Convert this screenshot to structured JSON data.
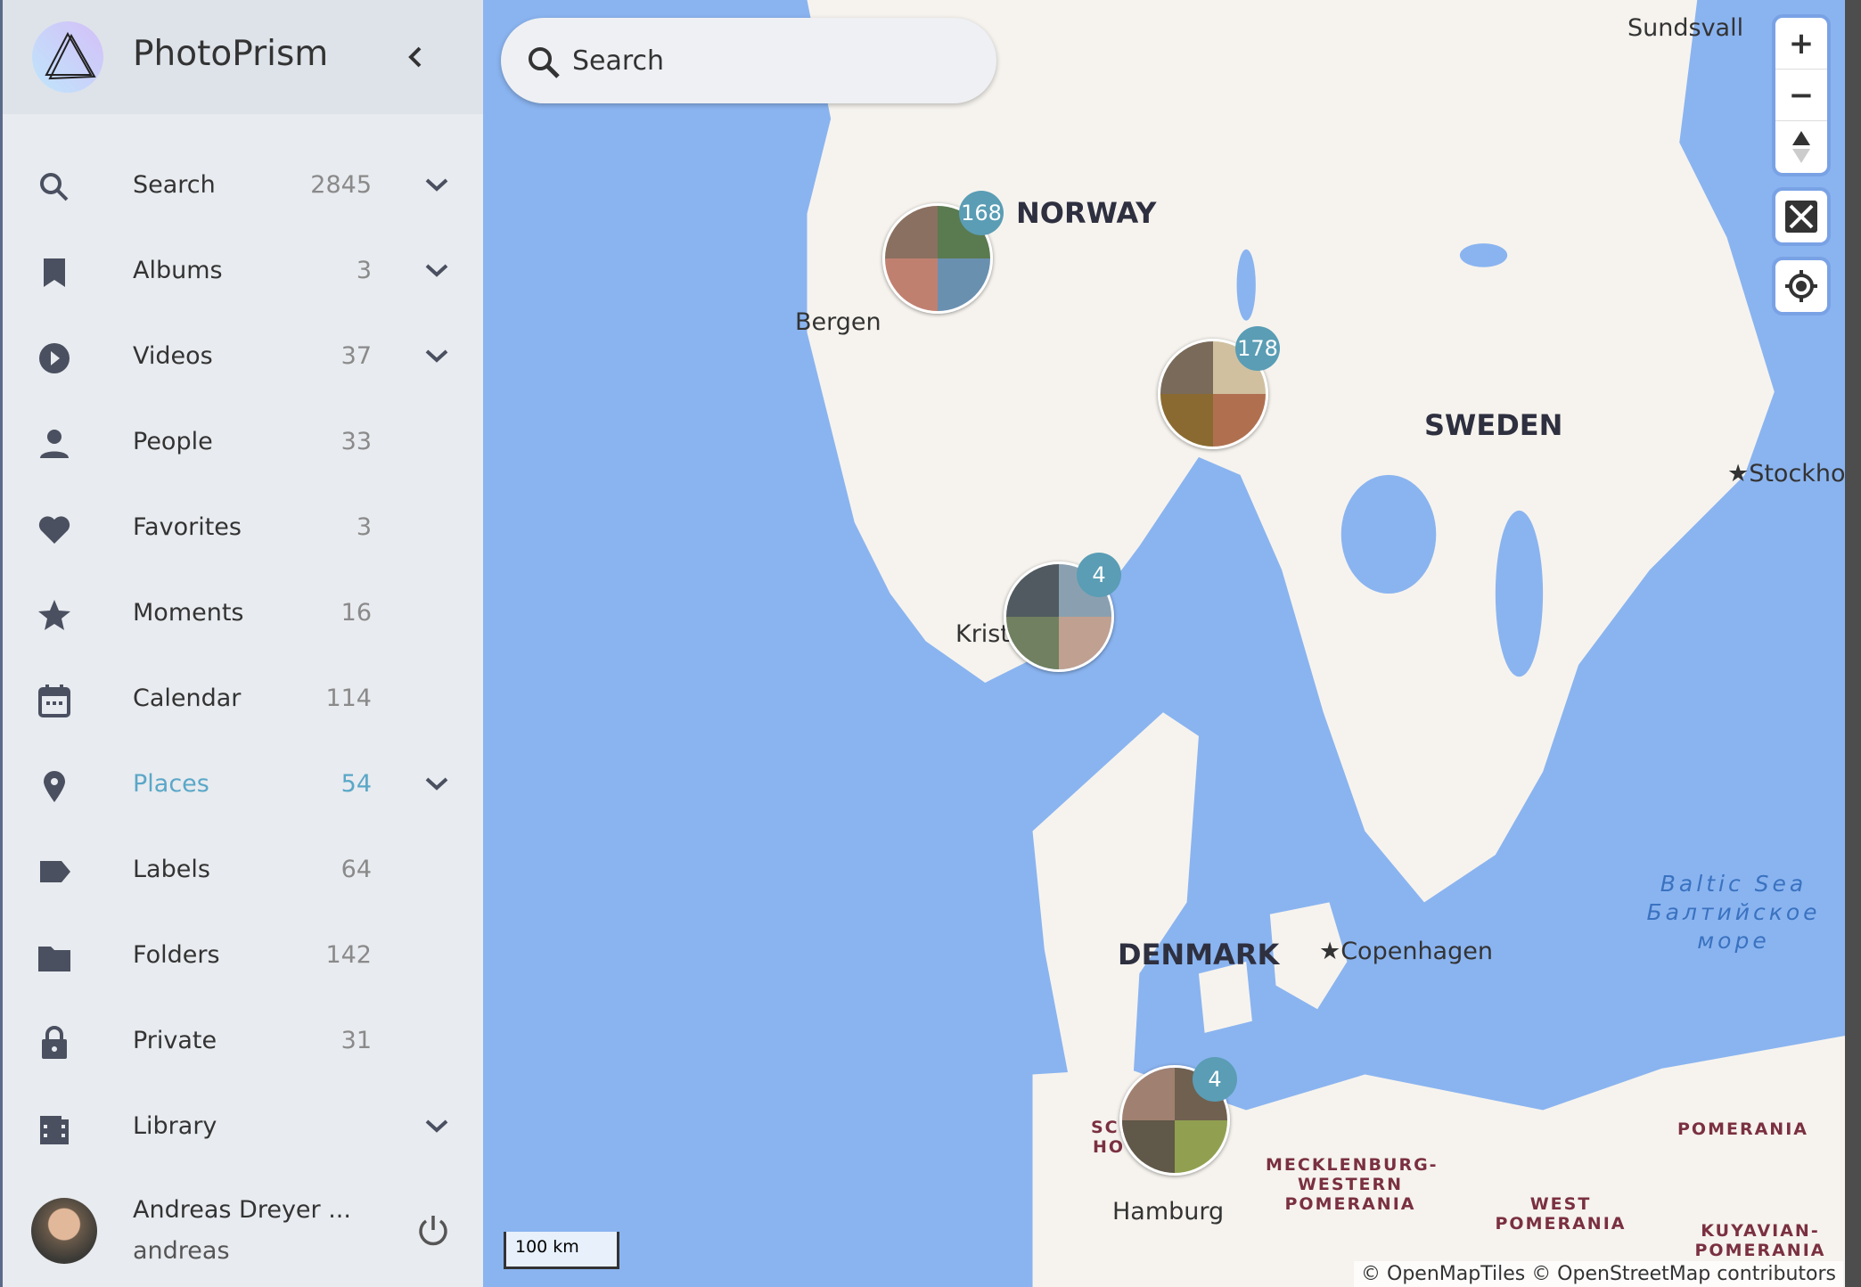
{
  "app": {
    "title": "PhotoPrism",
    "collapse_icon": "chevron-left-icon"
  },
  "nav": [
    {
      "label": "Search",
      "count": "2845",
      "icon": "search-icon",
      "expand": true
    },
    {
      "label": "Albums",
      "count": "3",
      "icon": "bookmark-icon",
      "expand": true
    },
    {
      "label": "Videos",
      "count": "37",
      "icon": "play-circle-icon",
      "expand": true
    },
    {
      "label": "People",
      "count": "33",
      "icon": "person-icon",
      "expand": false
    },
    {
      "label": "Favorites",
      "count": "3",
      "icon": "heart-icon",
      "expand": false
    },
    {
      "label": "Moments",
      "count": "16",
      "icon": "star-icon",
      "expand": false
    },
    {
      "label": "Calendar",
      "count": "114",
      "icon": "calendar-icon",
      "expand": false
    },
    {
      "label": "Places",
      "count": "54",
      "icon": "place-icon",
      "expand": true,
      "active": true
    },
    {
      "label": "Labels",
      "count": "64",
      "icon": "label-icon",
      "expand": false
    },
    {
      "label": "Folders",
      "count": "142",
      "icon": "folder-icon",
      "expand": false
    },
    {
      "label": "Private",
      "count": "31",
      "icon": "lock-icon",
      "expand": false
    },
    {
      "label": "Library",
      "count": "",
      "icon": "library-icon",
      "expand": true
    }
  ],
  "user": {
    "name": "Andreas Dreyer ...",
    "login": "andreas"
  },
  "search": {
    "placeholder": "Search"
  },
  "map": {
    "clusters": [
      {
        "count": "168"
      },
      {
        "count": "178"
      },
      {
        "count": "4"
      },
      {
        "count": "4"
      }
    ],
    "labels": {
      "sundsvall": "Sundsvall",
      "norway": "NORWAY",
      "bergen": "Bergen",
      "sweden": "SWEDEN",
      "stockholm": "★Stockholm",
      "kristi": "Kristi",
      "denmark": "DENMARK",
      "copenhagen": "★Copenhagen",
      "baltic": "Baltic Sea Балтийское море",
      "hamburg": "Hamburg",
      "mecklenburg": "MECKLENBURG-WESTERN POMERANIA",
      "west_pomerania": "WEST POMERANIA",
      "pomerania": "POMERANIA",
      "kuyavian": "KUYAVIAN-POMERANIA",
      "sch": "SCH HO"
    },
    "scale": "100 km",
    "attribution": "© OpenMapTiles © OpenStreetMap contributors",
    "colors": {
      "water": "#8ab4f0",
      "land": "#f6f3ee",
      "accent": "#5aa7c8",
      "badge": "#5a9db5"
    }
  }
}
